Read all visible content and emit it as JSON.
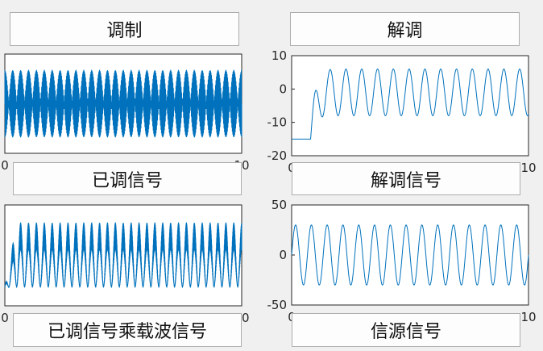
{
  "buttons": {
    "modulate": "调制",
    "demodulate": "解调",
    "modulated_signal": "已调信号",
    "demodulated_signal": "解调信号",
    "modulated_times_carrier": "已调信号乘载波信号",
    "source_signal": "信源信号"
  },
  "colors": {
    "plot_line": "#0072bd",
    "axes_bg": "#ffffff",
    "axes_edge": "#262626"
  },
  "chart_data": [
    {
      "id": "modulated",
      "type": "line",
      "title": "",
      "xlim": [
        0,
        10
      ],
      "ylim": [
        -1.3,
        1.3
      ],
      "x_ticklabels": [
        "0",
        "10"
      ],
      "y_ticklabels": [],
      "description_series": {
        "kind": "dsb-am",
        "carrier_cycles_per_unit": 50,
        "envelope_cycles": 15,
        "amplitude": 1.0
      }
    },
    {
      "id": "demodulated",
      "type": "line",
      "title": "",
      "xlim": [
        0,
        10
      ],
      "ylim": [
        -20,
        10
      ],
      "y_ticks": [
        -20,
        -10,
        0,
        10
      ],
      "x_ticklabels": [
        "0",
        "10"
      ],
      "description_series": {
        "kind": "filtered-sine",
        "baseline": -15,
        "start": 0.8,
        "offset": -1,
        "amplitude": 7,
        "cycles": 15
      }
    },
    {
      "id": "modulated_x_carrier",
      "type": "line",
      "title": "",
      "xlim": [
        0,
        10
      ],
      "ylim": [
        -0.5,
        2.2
      ],
      "x_ticklabels": [
        "0",
        "10"
      ],
      "y_ticklabels": [],
      "description_series": {
        "kind": "rectified-am",
        "carrier_cycles_per_unit": 50,
        "envelope_cycles": 15
      }
    },
    {
      "id": "source",
      "type": "line",
      "title": "",
      "xlim": [
        0,
        10
      ],
      "ylim": [
        -50,
        50
      ],
      "y_ticks": [
        -50,
        0,
        50
      ],
      "x_ticklabels": [
        "0",
        "10"
      ],
      "description_series": {
        "kind": "sine",
        "amplitude": 30,
        "cycles": 15
      }
    }
  ]
}
